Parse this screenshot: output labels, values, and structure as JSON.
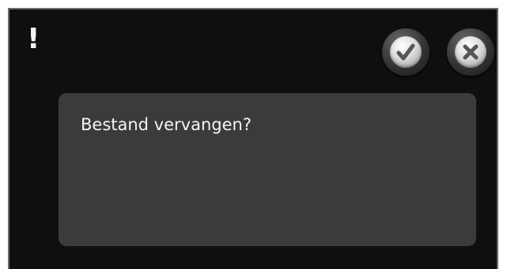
{
  "dialog": {
    "alert_symbol": "!",
    "message": "Bestand vervangen?",
    "confirm_icon": "checkmark-icon",
    "cancel_icon": "close-icon"
  },
  "colors": {
    "background": "#0f0f0f",
    "message_box": "#3b3b3b",
    "text": "#f4f4f4",
    "icon_glyph": "#555555"
  }
}
